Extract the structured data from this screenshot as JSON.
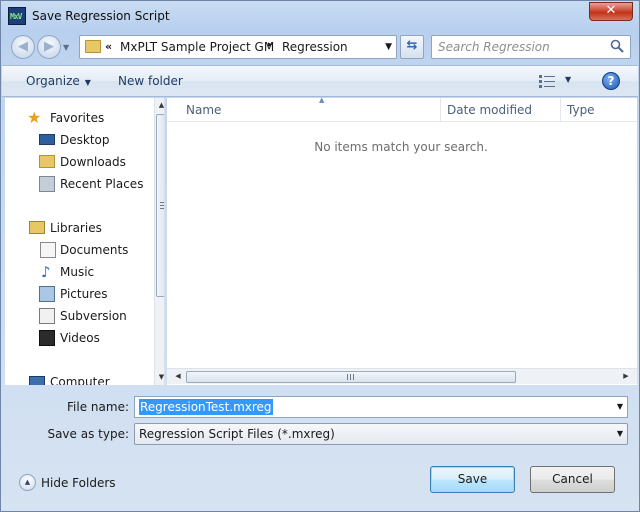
{
  "window": {
    "title": "Save Regression Script"
  },
  "title_bar": {
    "close_label": "✕"
  },
  "address_bar": {
    "chevron": "«",
    "crumbs": [
      "MxPLT Sample Project GM",
      "Regression"
    ],
    "separator": "▸"
  },
  "search": {
    "placeholder": "Search Regression"
  },
  "toolbar": {
    "organize_label": "Organize",
    "new_folder_label": "New folder",
    "help_label": "?"
  },
  "nav_pane": {
    "items": [
      {
        "label": "Favorites",
        "icon": "star-icon"
      },
      {
        "label": "Desktop",
        "icon": "desktop-icon"
      },
      {
        "label": "Downloads",
        "icon": "downloads-folder-icon"
      },
      {
        "label": "Recent Places",
        "icon": "recent-places-icon"
      },
      {
        "label": "Libraries",
        "icon": "libraries-icon"
      },
      {
        "label": "Documents",
        "icon": "documents-icon"
      },
      {
        "label": "Music",
        "icon": "music-icon"
      },
      {
        "label": "Pictures",
        "icon": "pictures-icon"
      },
      {
        "label": "Subversion",
        "icon": "subversion-icon"
      },
      {
        "label": "Videos",
        "icon": "videos-icon"
      },
      {
        "label": "Computer",
        "icon": "computer-icon"
      }
    ]
  },
  "file_list": {
    "columns": [
      "Name",
      "Date modified",
      "Type"
    ],
    "empty_message": "No items match your search."
  },
  "form": {
    "file_name_label": "File name:",
    "file_name_value": "RegressionTest.mxreg",
    "save_as_type_label": "Save as type:",
    "save_as_type_value": "Regression Script Files (*.mxreg)"
  },
  "footer": {
    "hide_folders_label": "Hide Folders",
    "save_label": "Save",
    "cancel_label": "Cancel"
  },
  "colors": {
    "selection": "#3399ff",
    "close_button": "#c1331a",
    "save_button_border": "#3c7fb1"
  }
}
